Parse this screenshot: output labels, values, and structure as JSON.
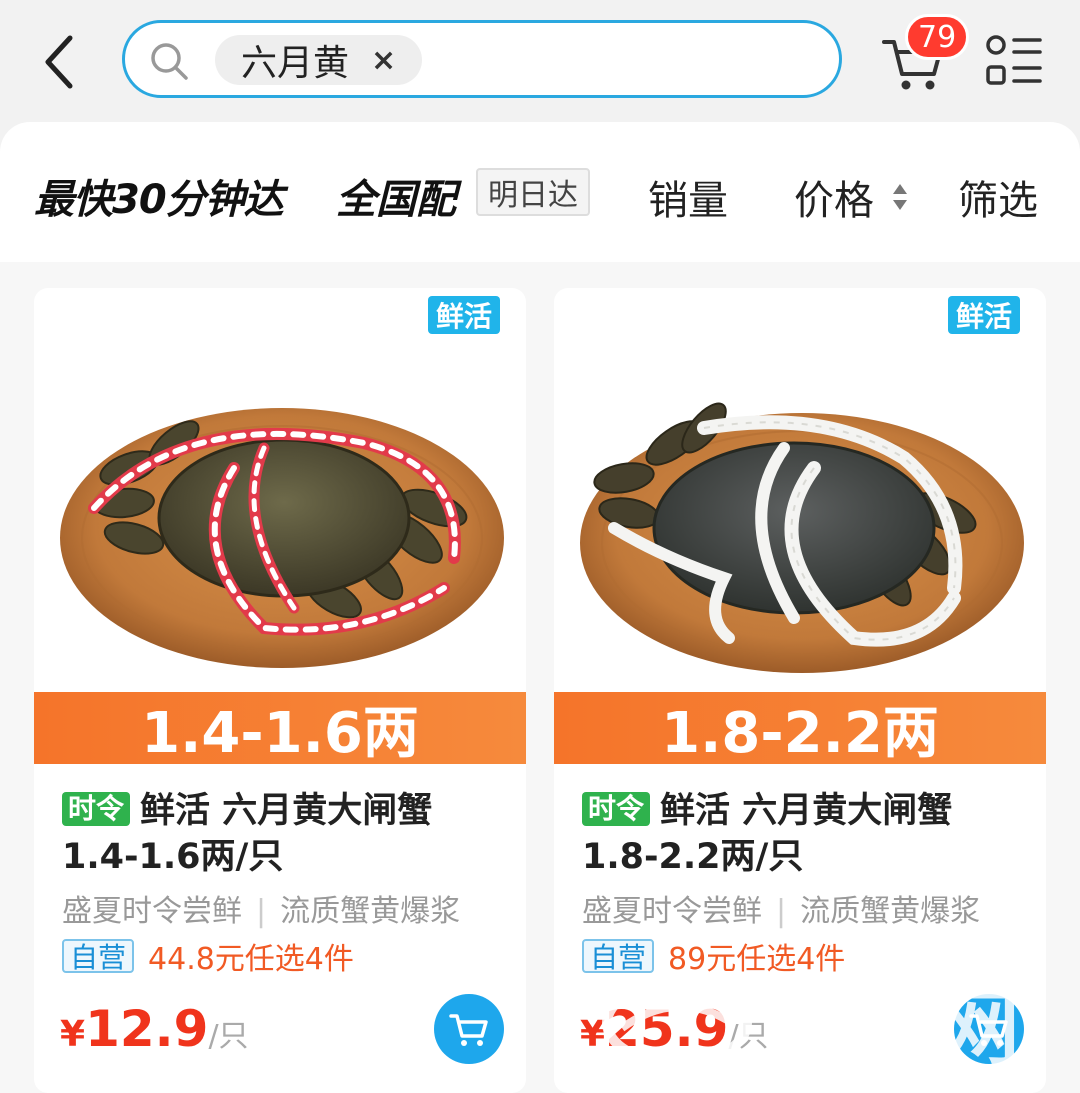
{
  "header": {
    "search_chip": "六月黄",
    "chip_close": "×",
    "cart_count": "79"
  },
  "filters": {
    "fastest": "最快30分钟达",
    "nationwide": "全国配",
    "tomorrow": "明日达",
    "sales": "销量",
    "price": "价格",
    "filter": "筛选"
  },
  "products": [
    {
      "fresh_tag": "鲜活",
      "spec": "1.4-1.6两",
      "season_tag": "时令",
      "title": "鲜活 六月黄大闸蟹 1.4-1.6两/只",
      "sub_left": "盛夏时令尝鲜",
      "sub_sep": "|",
      "sub_right": "流质蟹黄爆浆",
      "self_tag": "自营",
      "promo": "44.8元任选4件",
      "price_symbol": "¥",
      "price": "12.9",
      "unit": "/只",
      "rope_color": "#e23a4a"
    },
    {
      "fresh_tag": "鲜活",
      "spec": "1.8-2.2两",
      "season_tag": "时令",
      "title": "鲜活 六月黄大闸蟹 1.8-2.2两/只",
      "sub_left": "盛夏时令尝鲜",
      "sub_sep": "|",
      "sub_right": "流质蟹黄爆浆",
      "self_tag": "自营",
      "promo": "89元任选4件",
      "price_symbol": "¥",
      "price": "25.9",
      "unit": "/只",
      "rope_color": "#f4f4f2"
    }
  ],
  "watermark": "杭州网",
  "colors": {
    "accent": "#2aa8e0",
    "spec_bar": "#f5742a",
    "price": "#f0341c",
    "season": "#2fb24d",
    "badge": "#ff3b2f"
  }
}
